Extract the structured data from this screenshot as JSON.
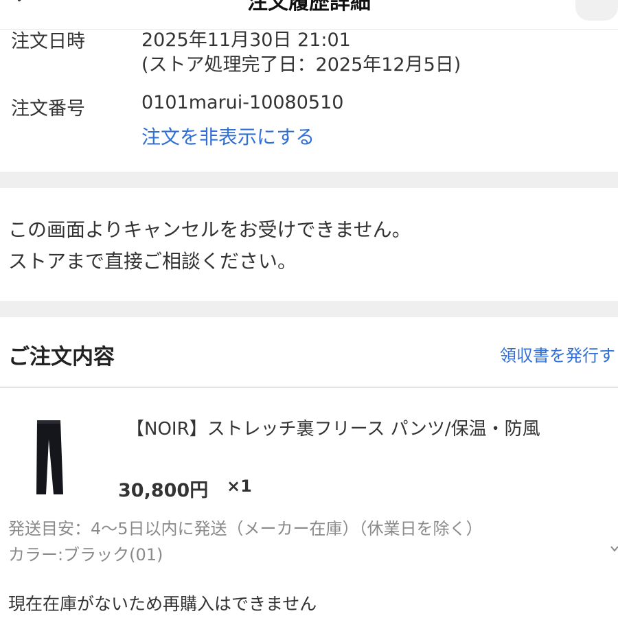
{
  "header": {
    "title": "注文履歴詳細"
  },
  "order": {
    "datetime_label": "注文日時",
    "datetime_value": "2025年11月30日 21:01",
    "store_complete": "(ストア処理完了日：2025年12月5日)",
    "number_label": "注文番号",
    "number_value": "0101marui-10080510",
    "hide_link": "注文を非表示にする"
  },
  "notice": {
    "line1": "この画面よりキャンセルをお受けできません。",
    "line2": "ストアまで直接ご相談ください。"
  },
  "contents": {
    "title": "ご注文内容",
    "receipt_link": "領収書を発行す"
  },
  "item": {
    "name": "【NOIR】ストレッチ裏フリース パンツ/保温・防風",
    "price": "30,800円",
    "quantity": "×1",
    "shipping": "発送目安：4〜5日以内に発送（メーカー在庫）（休業日を除く）",
    "color": "カラー:ブラック(01)",
    "stock_note": "現在在庫がないため再購入はできません",
    "image_icon": "pants-icon"
  },
  "colors": {
    "link": "#2f6fd6",
    "band": "#efefef",
    "muted": "#8a8a8a"
  }
}
